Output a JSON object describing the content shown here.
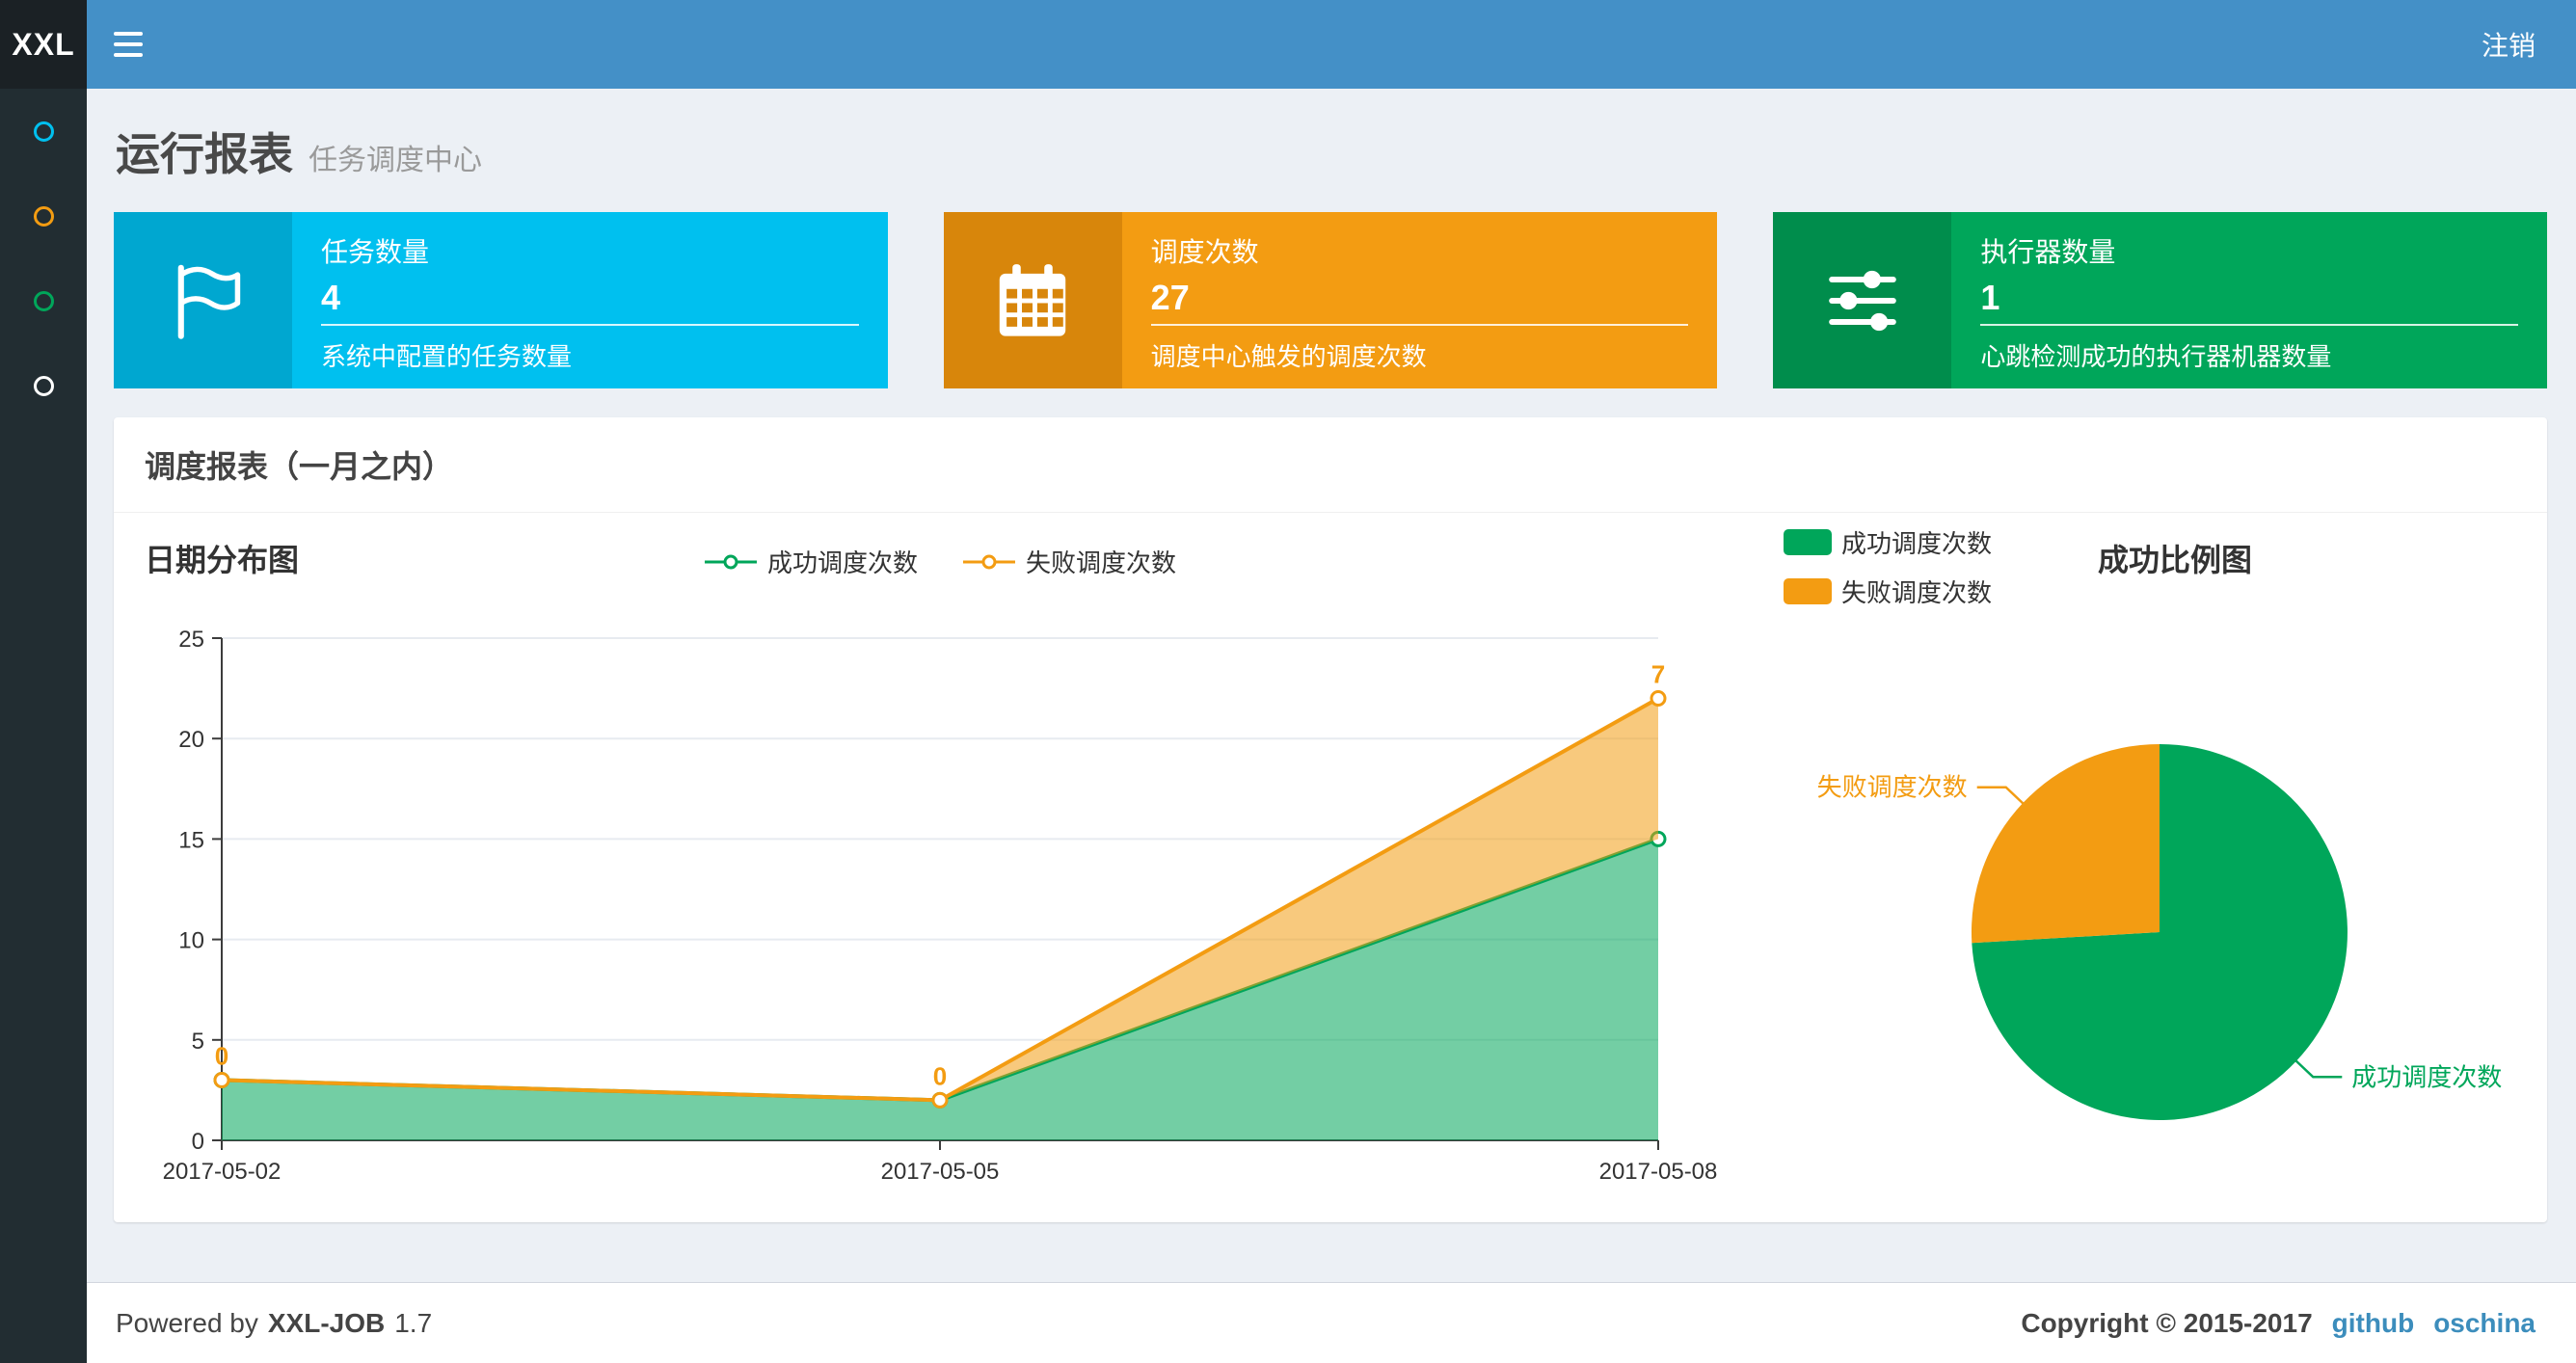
{
  "navbar": {
    "logo": "XXL",
    "logout_label": "注销"
  },
  "sidebar": {
    "items": [
      {
        "id": "report",
        "color": "#00c0ef"
      },
      {
        "id": "jobinfo",
        "color": "#f39c12"
      },
      {
        "id": "joblog",
        "color": "#00a65a"
      },
      {
        "id": "group",
        "color": "#ffffff"
      }
    ]
  },
  "page_header": {
    "title": "运行报表",
    "subtitle": "任务调度中心"
  },
  "stat_boxes": [
    {
      "id": "job-count",
      "icon": "flag-icon",
      "label": "任务数量",
      "value": "4",
      "desc": "系统中配置的任务数量",
      "color": "#00c0ef",
      "icon_bg": "#00a7d0"
    },
    {
      "id": "trigger-count",
      "icon": "calendar-icon",
      "label": "调度次数",
      "value": "27",
      "desc": "调度中心触发的调度次数",
      "color": "#f39c12",
      "icon_bg": "#d8860b"
    },
    {
      "id": "executor-count",
      "icon": "sliders-icon",
      "label": "执行器数量",
      "value": "1",
      "desc": "心跳检测成功的执行器机器数量",
      "color": "#00a65a",
      "icon_bg": "#008d4c"
    }
  ],
  "panel": {
    "title": "调度报表（一月之内）"
  },
  "chart_data": [
    {
      "type": "area",
      "title": "日期分布图",
      "stacked": true,
      "x": [
        "2017-05-02",
        "2017-05-05",
        "2017-05-08"
      ],
      "series": [
        {
          "id": "success",
          "name": "成功调度次数",
          "values": [
            3,
            2,
            15
          ],
          "color": "#00a65a"
        },
        {
          "id": "fail",
          "name": "失败调度次数",
          "values": [
            0,
            0,
            7
          ],
          "color": "#f39c12",
          "point_labels": [
            "0",
            "0",
            "7"
          ]
        }
      ],
      "ylim": [
        0,
        25
      ],
      "yticks": [
        0,
        5,
        10,
        15,
        20,
        25
      ],
      "grid": true,
      "legend_position": "top-center"
    },
    {
      "type": "pie",
      "title": "成功比例图",
      "slices": [
        {
          "id": "success",
          "name": "成功调度次数",
          "value": 20,
          "color": "#00a65a"
        },
        {
          "id": "fail",
          "name": "失败调度次数",
          "value": 7,
          "color": "#f39c12"
        }
      ],
      "legend_position": "top-left",
      "label_lines": true
    }
  ],
  "footer": {
    "powered_by": "Powered by",
    "product": "XXL-JOB",
    "version": "1.7",
    "copyright": "Copyright © 2015-2017",
    "links": [
      {
        "id": "github",
        "label": "github"
      },
      {
        "id": "oschina",
        "label": "oschina"
      }
    ]
  }
}
